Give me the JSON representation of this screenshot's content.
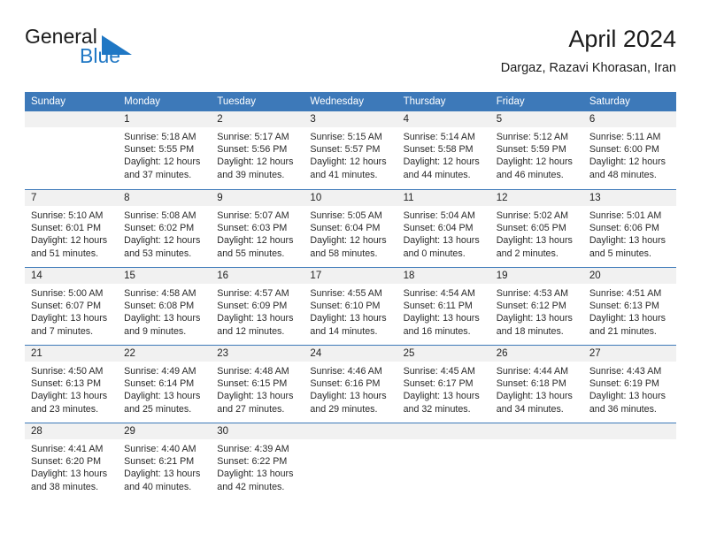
{
  "brand": {
    "name_part1": "General",
    "name_part2": "Blue",
    "accent_color": "#1f77c4",
    "triangle_icon": "triangle-icon"
  },
  "header": {
    "title": "April 2024",
    "subtitle": "Dargaz, Razavi Khorasan, Iran"
  },
  "calendar": {
    "header_bg": "#3d79b9",
    "weekdays": [
      "Sunday",
      "Monday",
      "Tuesday",
      "Wednesday",
      "Thursday",
      "Friday",
      "Saturday"
    ],
    "weeks": [
      [
        {
          "day": "",
          "lines": []
        },
        {
          "day": "1",
          "lines": [
            "Sunrise: 5:18 AM",
            "Sunset: 5:55 PM",
            "Daylight: 12 hours",
            "and 37 minutes."
          ]
        },
        {
          "day": "2",
          "lines": [
            "Sunrise: 5:17 AM",
            "Sunset: 5:56 PM",
            "Daylight: 12 hours",
            "and 39 minutes."
          ]
        },
        {
          "day": "3",
          "lines": [
            "Sunrise: 5:15 AM",
            "Sunset: 5:57 PM",
            "Daylight: 12 hours",
            "and 41 minutes."
          ]
        },
        {
          "day": "4",
          "lines": [
            "Sunrise: 5:14 AM",
            "Sunset: 5:58 PM",
            "Daylight: 12 hours",
            "and 44 minutes."
          ]
        },
        {
          "day": "5",
          "lines": [
            "Sunrise: 5:12 AM",
            "Sunset: 5:59 PM",
            "Daylight: 12 hours",
            "and 46 minutes."
          ]
        },
        {
          "day": "6",
          "lines": [
            "Sunrise: 5:11 AM",
            "Sunset: 6:00 PM",
            "Daylight: 12 hours",
            "and 48 minutes."
          ]
        }
      ],
      [
        {
          "day": "7",
          "lines": [
            "Sunrise: 5:10 AM",
            "Sunset: 6:01 PM",
            "Daylight: 12 hours",
            "and 51 minutes."
          ]
        },
        {
          "day": "8",
          "lines": [
            "Sunrise: 5:08 AM",
            "Sunset: 6:02 PM",
            "Daylight: 12 hours",
            "and 53 minutes."
          ]
        },
        {
          "day": "9",
          "lines": [
            "Sunrise: 5:07 AM",
            "Sunset: 6:03 PM",
            "Daylight: 12 hours",
            "and 55 minutes."
          ]
        },
        {
          "day": "10",
          "lines": [
            "Sunrise: 5:05 AM",
            "Sunset: 6:04 PM",
            "Daylight: 12 hours",
            "and 58 minutes."
          ]
        },
        {
          "day": "11",
          "lines": [
            "Sunrise: 5:04 AM",
            "Sunset: 6:04 PM",
            "Daylight: 13 hours",
            "and 0 minutes."
          ]
        },
        {
          "day": "12",
          "lines": [
            "Sunrise: 5:02 AM",
            "Sunset: 6:05 PM",
            "Daylight: 13 hours",
            "and 2 minutes."
          ]
        },
        {
          "day": "13",
          "lines": [
            "Sunrise: 5:01 AM",
            "Sunset: 6:06 PM",
            "Daylight: 13 hours",
            "and 5 minutes."
          ]
        }
      ],
      [
        {
          "day": "14",
          "lines": [
            "Sunrise: 5:00 AM",
            "Sunset: 6:07 PM",
            "Daylight: 13 hours",
            "and 7 minutes."
          ]
        },
        {
          "day": "15",
          "lines": [
            "Sunrise: 4:58 AM",
            "Sunset: 6:08 PM",
            "Daylight: 13 hours",
            "and 9 minutes."
          ]
        },
        {
          "day": "16",
          "lines": [
            "Sunrise: 4:57 AM",
            "Sunset: 6:09 PM",
            "Daylight: 13 hours",
            "and 12 minutes."
          ]
        },
        {
          "day": "17",
          "lines": [
            "Sunrise: 4:55 AM",
            "Sunset: 6:10 PM",
            "Daylight: 13 hours",
            "and 14 minutes."
          ]
        },
        {
          "day": "18",
          "lines": [
            "Sunrise: 4:54 AM",
            "Sunset: 6:11 PM",
            "Daylight: 13 hours",
            "and 16 minutes."
          ]
        },
        {
          "day": "19",
          "lines": [
            "Sunrise: 4:53 AM",
            "Sunset: 6:12 PM",
            "Daylight: 13 hours",
            "and 18 minutes."
          ]
        },
        {
          "day": "20",
          "lines": [
            "Sunrise: 4:51 AM",
            "Sunset: 6:13 PM",
            "Daylight: 13 hours",
            "and 21 minutes."
          ]
        }
      ],
      [
        {
          "day": "21",
          "lines": [
            "Sunrise: 4:50 AM",
            "Sunset: 6:13 PM",
            "Daylight: 13 hours",
            "and 23 minutes."
          ]
        },
        {
          "day": "22",
          "lines": [
            "Sunrise: 4:49 AM",
            "Sunset: 6:14 PM",
            "Daylight: 13 hours",
            "and 25 minutes."
          ]
        },
        {
          "day": "23",
          "lines": [
            "Sunrise: 4:48 AM",
            "Sunset: 6:15 PM",
            "Daylight: 13 hours",
            "and 27 minutes."
          ]
        },
        {
          "day": "24",
          "lines": [
            "Sunrise: 4:46 AM",
            "Sunset: 6:16 PM",
            "Daylight: 13 hours",
            "and 29 minutes."
          ]
        },
        {
          "day": "25",
          "lines": [
            "Sunrise: 4:45 AM",
            "Sunset: 6:17 PM",
            "Daylight: 13 hours",
            "and 32 minutes."
          ]
        },
        {
          "day": "26",
          "lines": [
            "Sunrise: 4:44 AM",
            "Sunset: 6:18 PM",
            "Daylight: 13 hours",
            "and 34 minutes."
          ]
        },
        {
          "day": "27",
          "lines": [
            "Sunrise: 4:43 AM",
            "Sunset: 6:19 PM",
            "Daylight: 13 hours",
            "and 36 minutes."
          ]
        }
      ],
      [
        {
          "day": "28",
          "lines": [
            "Sunrise: 4:41 AM",
            "Sunset: 6:20 PM",
            "Daylight: 13 hours",
            "and 38 minutes."
          ]
        },
        {
          "day": "29",
          "lines": [
            "Sunrise: 4:40 AM",
            "Sunset: 6:21 PM",
            "Daylight: 13 hours",
            "and 40 minutes."
          ]
        },
        {
          "day": "30",
          "lines": [
            "Sunrise: 4:39 AM",
            "Sunset: 6:22 PM",
            "Daylight: 13 hours",
            "and 42 minutes."
          ]
        },
        {
          "day": "",
          "lines": []
        },
        {
          "day": "",
          "lines": []
        },
        {
          "day": "",
          "lines": []
        },
        {
          "day": "",
          "lines": []
        }
      ]
    ]
  }
}
